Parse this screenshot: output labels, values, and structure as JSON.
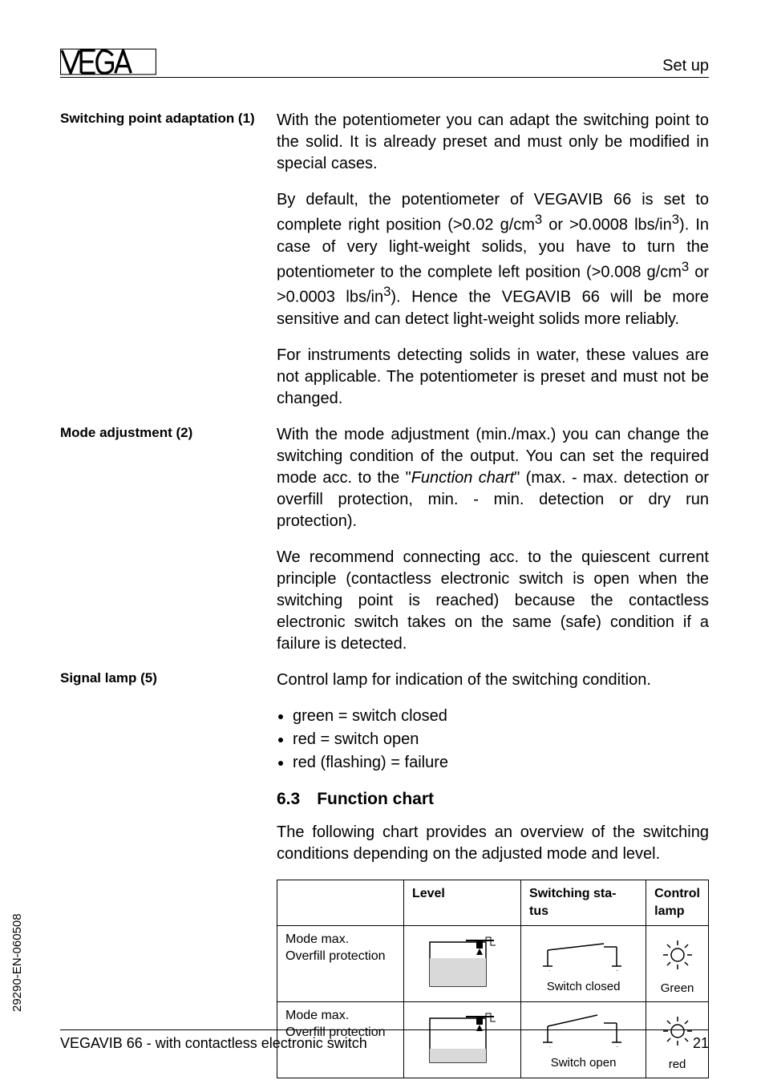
{
  "header": {
    "right": "Set up"
  },
  "sections": {
    "spa": {
      "label": "Switching point adaptation (1)",
      "p1": "With the potentiometer you can adapt the switching point to the solid. It is already preset and must only be modified in special cases.",
      "p2_pre": "By default, the potentiometer of VEGAVIB 66 is set to complete right position (>0.02 g/cm",
      "p2_mid1": " or >0.0008 lbs/in",
      "p2_mid2": "). In case of very light-weight solids, you have to turn the potentiometer to the complete left position (>0.008 g/cm",
      "p2_mid3": " or >0.0003 lbs/in",
      "p2_end": "). Hence the VEGAVIB 66 will be more sensitive and can detect light-weight solids more reliably.",
      "p3": "For instruments detecting solids in water, these values are not applicable. The potentiometer is preset and must not be changed."
    },
    "mode": {
      "label": "Mode adjustment (2)",
      "p1_pre": "With the mode adjustment (min./max.) you can change the switching condition of the output. You can set the required mode acc. to the \"",
      "p1_em": "Function chart",
      "p1_post": "\" (max. - max. detection or overfill protection, min. - min. detection or dry run protection).",
      "p2": "We recommend connecting acc. to the quiescent current principle (contactless electronic switch is open when the switching point is reached) because the contactless electronic switch takes on the same (safe) condition if a failure is detected."
    },
    "signal": {
      "label": "Signal lamp (5)",
      "p1": "Control lamp for indication of the switching condition.",
      "b1": "green = switch closed",
      "b2": "red = switch open",
      "b3": "red (flashing) = failure"
    }
  },
  "subsection_title": "6.3 Function chart",
  "subsection_intro": "The following chart provides an overview of the switching conditions depending on the adjusted mode and level.",
  "chart_data": {
    "type": "table",
    "headers": [
      "",
      "Level",
      "Switching status",
      "Control lamp"
    ],
    "rows": [
      {
        "mode_line1": "Mode max.",
        "mode_line2": "Overfill protection",
        "level_state": "high",
        "switch_label": "Switch closed",
        "lamp_label": "Green"
      },
      {
        "mode_line1": "Mode max.",
        "mode_line2": "Overfill protection",
        "level_state": "low",
        "switch_label": "Switch open",
        "lamp_label": "red"
      }
    ]
  },
  "footer": {
    "left": "VEGAVIB 66 - with contactless electronic switch",
    "right": "21"
  },
  "docnum": "29290-EN-060508"
}
